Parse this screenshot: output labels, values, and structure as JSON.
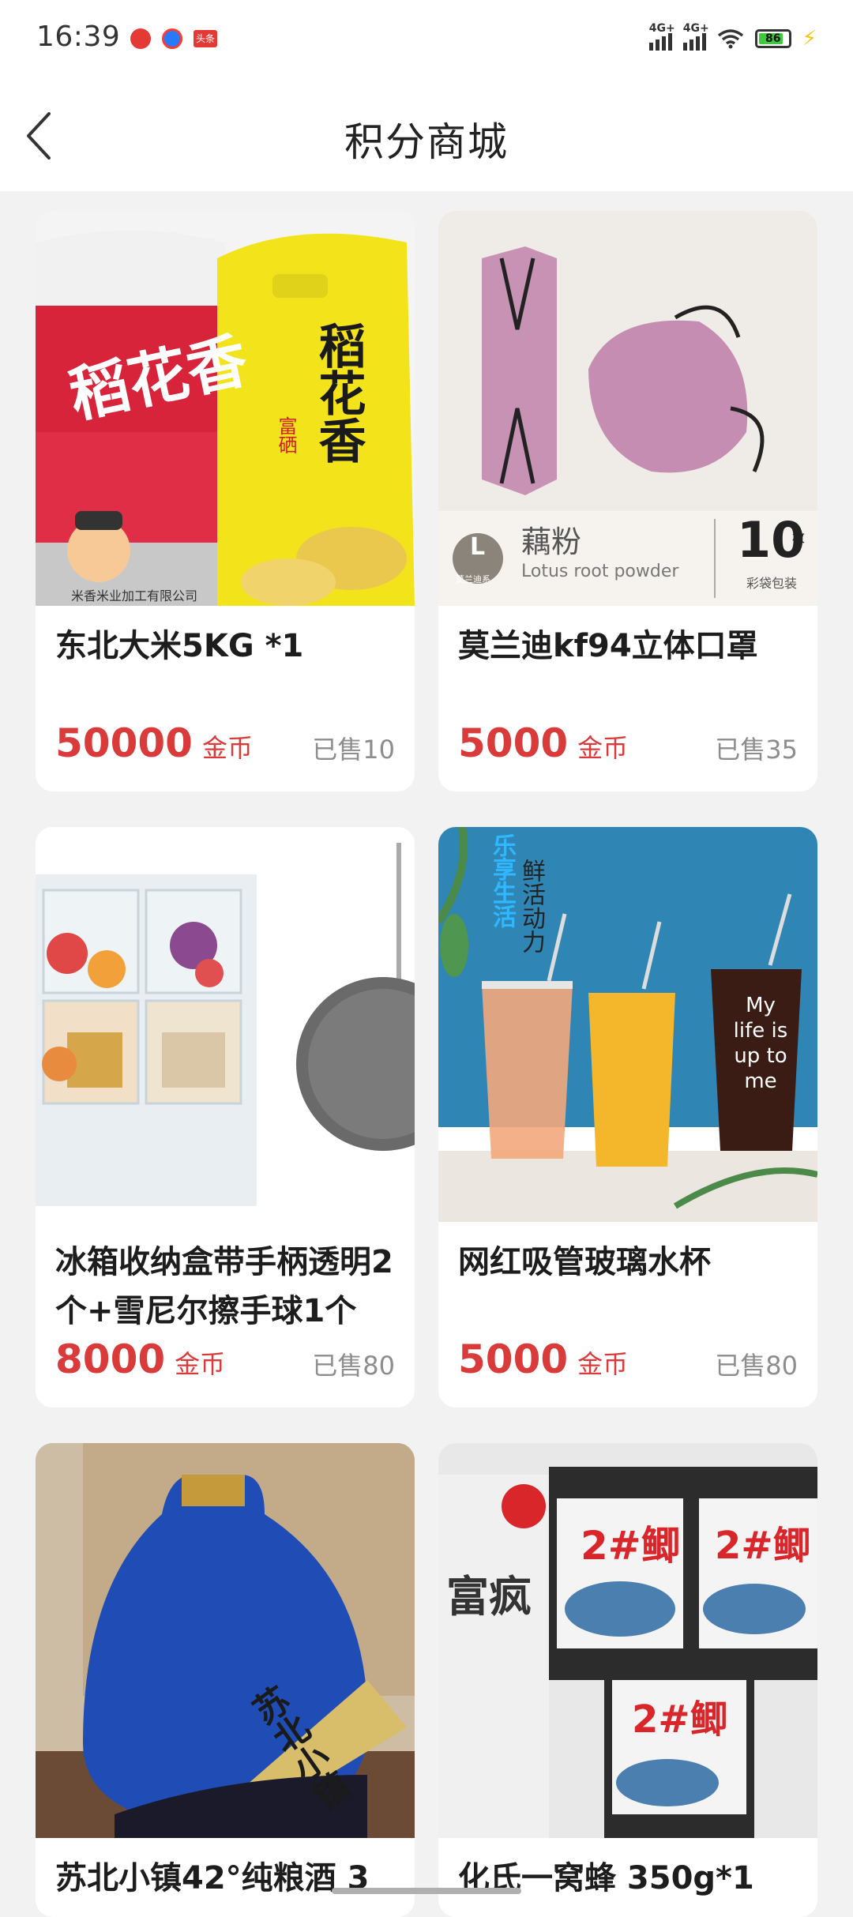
{
  "status": {
    "time": "16:39",
    "app_badge": "头条",
    "net1": "4G+",
    "net2": "4G+",
    "battery": "86"
  },
  "header": {
    "title": "积分商城"
  },
  "products": [
    {
      "title": "东北大米5KG *1",
      "price": "50000",
      "unit": "金币",
      "sold": "已售10",
      "image_text": [
        "稻花香",
        "稻花香",
        "富硒",
        "米香米业加工有限公司"
      ]
    },
    {
      "title": "莫兰迪kf94立体口罩",
      "price": "5000",
      "unit": "金币",
      "sold": "已售35",
      "image_text": [
        "L",
        "莫兰迪系",
        "藕粉",
        "Lotus root powder",
        "10",
        "枚",
        "彩袋包装"
      ]
    },
    {
      "title": "冰箱收纳盒带手柄透明2个+雪尼尔擦手球1个",
      "price": "8000",
      "unit": "金币",
      "sold": "已售80",
      "image_text": []
    },
    {
      "title": "网红吸管玻璃水杯",
      "price": "5000",
      "unit": "金币",
      "sold": "已售80",
      "image_text": [
        "乐享生活",
        "鲜活动力",
        "My life is up to me"
      ]
    },
    {
      "title": "苏北小镇42°纯粮酒 3",
      "price": "",
      "unit": "",
      "sold": "",
      "image_text": [
        "苏北小镇"
      ]
    },
    {
      "title": "化氏一窝蜂 350g*1",
      "price": "",
      "unit": "",
      "sold": "",
      "image_text": [
        "2#鲫",
        "2#鲫",
        "2#鲫",
        "富疯"
      ]
    }
  ],
  "colors": {
    "price": "#d93a3a",
    "background": "#f2f2f2"
  },
  "icons": {
    "back": "chevron-left-icon"
  }
}
